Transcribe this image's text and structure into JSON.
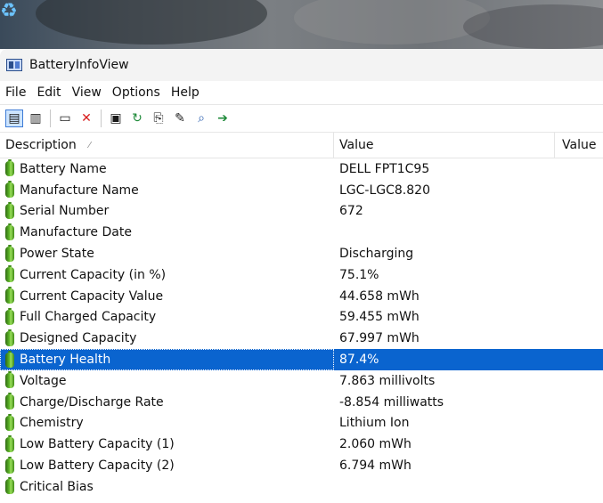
{
  "window": {
    "title": "BatteryInfoView"
  },
  "menu": [
    "File",
    "Edit",
    "View",
    "Options",
    "Help"
  ],
  "toolbar": {
    "buttons": [
      {
        "name": "html-report-icon",
        "glyph": "▤",
        "active": true
      },
      {
        "name": "text-report-icon",
        "glyph": "▥",
        "active": false
      },
      {
        "name": "properties-window-icon",
        "glyph": "▭",
        "active": false
      },
      {
        "name": "delete-icon",
        "glyph": "✕",
        "active": false
      },
      {
        "name": "save-icon",
        "glyph": "▣",
        "active": false
      },
      {
        "name": "refresh-icon",
        "glyph": "↻",
        "active": false
      },
      {
        "name": "copy-icon",
        "glyph": "⎘",
        "active": false
      },
      {
        "name": "properties-icon",
        "glyph": "✎",
        "active": false
      },
      {
        "name": "find-icon",
        "glyph": "⌕",
        "active": false
      },
      {
        "name": "exit-icon",
        "glyph": "➔",
        "active": false
      }
    ]
  },
  "columns": {
    "description": "Description",
    "value": "Value",
    "value2": "Value"
  },
  "rows": [
    {
      "label": "Battery Name",
      "value": "DELL FPT1C95"
    },
    {
      "label": "Manufacture Name",
      "value": "LGC-LGC8.820"
    },
    {
      "label": "Serial Number",
      "value": "672"
    },
    {
      "label": "Manufacture Date",
      "value": ""
    },
    {
      "label": "Power State",
      "value": "Discharging"
    },
    {
      "label": "Current Capacity (in %)",
      "value": "75.1%"
    },
    {
      "label": "Current Capacity Value",
      "value": "44.658 mWh"
    },
    {
      "label": "Full Charged Capacity",
      "value": "59.455 mWh"
    },
    {
      "label": "Designed Capacity",
      "value": "67.997 mWh"
    },
    {
      "label": "Battery Health",
      "value": "87.4%",
      "selected": true
    },
    {
      "label": "Voltage",
      "value": "7.863 millivolts"
    },
    {
      "label": "Charge/Discharge Rate",
      "value": "-8.854 milliwatts"
    },
    {
      "label": "Chemistry",
      "value": "Lithium Ion"
    },
    {
      "label": "Low Battery Capacity (1)",
      "value": "2.060 mWh"
    },
    {
      "label": "Low Battery Capacity (2)",
      "value": "6.794 mWh"
    },
    {
      "label": "Critical Bias",
      "value": ""
    }
  ],
  "colors": {
    "selection": "#0a64cf",
    "battery_green": "#5fb82a",
    "delete_red": "#d81e1e"
  }
}
